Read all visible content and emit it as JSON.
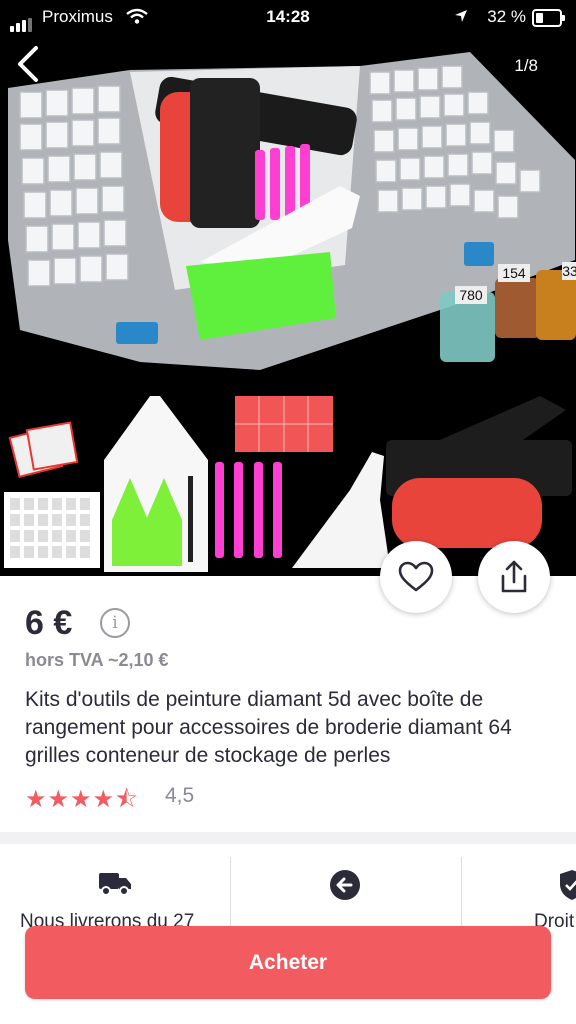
{
  "status_bar": {
    "carrier": "Proximus",
    "time": "14:28",
    "battery": "32 %"
  },
  "image_viewer": {
    "counter": "1/8",
    "box_tags": [
      "154",
      "780",
      "33"
    ]
  },
  "product": {
    "price": "6 €",
    "tax_note": "hors TVA ~2,10 €",
    "title": "Kits d'outils de peinture diamant 5d avec boîte de rangement pour accessoires de broderie diamant 64 grilles conteneur de stockage de perles",
    "stars": "★★★★⯪",
    "rating": "4,5",
    "rating_value": 4.5
  },
  "features": [
    {
      "icon": "truck-icon",
      "label": "Nous livrerons du 27"
    },
    {
      "icon": "return-arrow-icon",
      "label": ""
    },
    {
      "icon": "shield-icon",
      "label": "Droit"
    }
  ],
  "cta": {
    "buy_label": "Acheter"
  },
  "colors": {
    "accent": "#f25c60",
    "text": "#2b2b3a",
    "muted": "#8a8a93"
  }
}
